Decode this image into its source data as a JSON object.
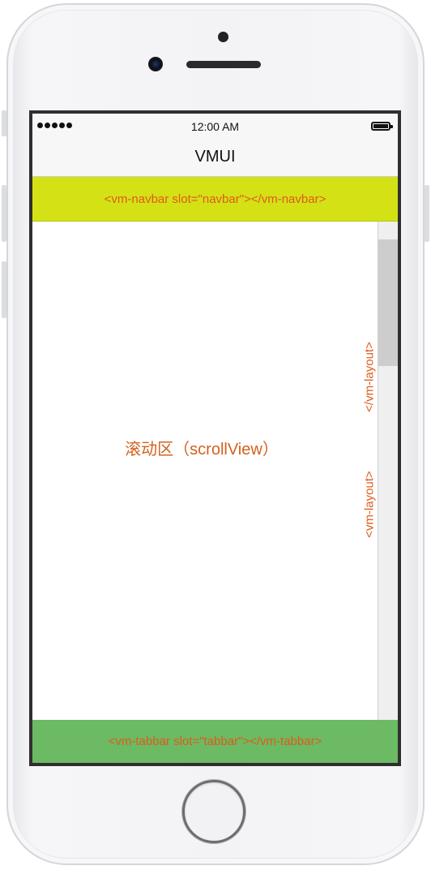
{
  "status_bar": {
    "time": "12:00 AM",
    "signal_icon": "signal-dots-icon",
    "battery_icon": "battery-icon"
  },
  "app": {
    "title": "VMUI"
  },
  "navbar_slot": {
    "text": "<vm-navbar slot=\"navbar\"></vm-navbar>",
    "background": "#d4e215"
  },
  "scroll_view": {
    "label": "滚动区（scrollView）",
    "layout_open": "<vm-layout>",
    "layout_close": "</vm-layout>"
  },
  "tabbar_slot": {
    "text": "<vm-tabbar slot=\"tabbar\"></vm-tabbar>",
    "background": "#6cba63"
  },
  "colors": {
    "accent_text": "#e05a1c"
  }
}
